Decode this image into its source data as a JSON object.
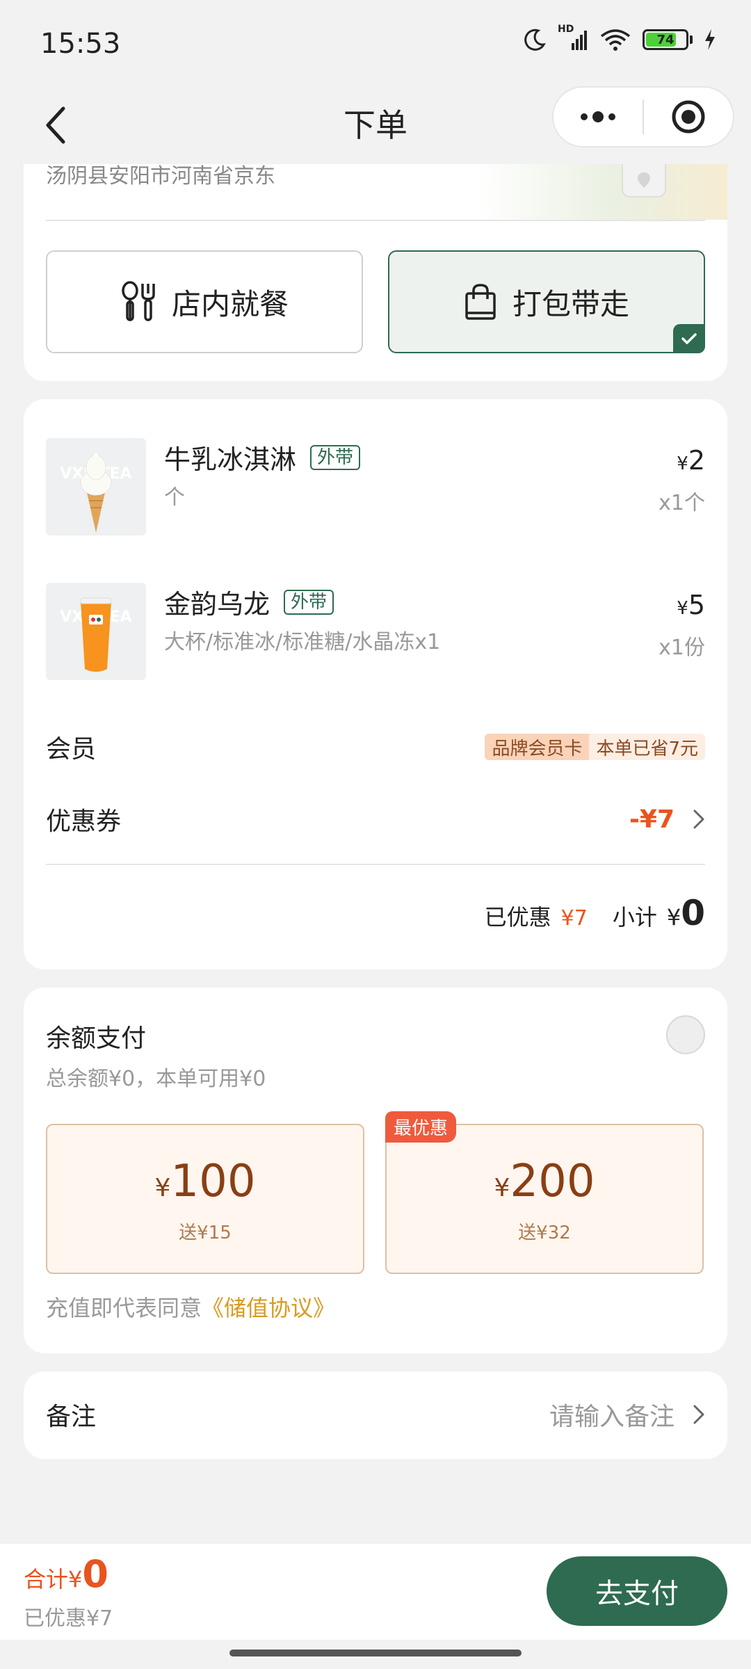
{
  "status": {
    "time": "15:53",
    "battery": "74",
    "network": "HD"
  },
  "nav": {
    "title": "下单"
  },
  "address": {
    "text": "汤阴县安阳市河南省京东"
  },
  "modes": {
    "dine_in": "店内就餐",
    "takeaway": "打包带走",
    "selected": "takeaway"
  },
  "items": [
    {
      "name": "牛乳冰淇淋",
      "tag": "外带",
      "spec": "个",
      "currency": "¥",
      "price": "2",
      "qty": "x1个"
    },
    {
      "name": "金韵乌龙",
      "tag": "外带",
      "spec": "大杯/标准冰/标准糖/水晶冻x1",
      "currency": "¥",
      "price": "5",
      "qty": "x1份"
    }
  ],
  "member": {
    "label": "会员",
    "badge": "品牌会员卡",
    "saved": "本单已省7元"
  },
  "coupon": {
    "label": "优惠券",
    "value": "-¥7"
  },
  "summary": {
    "discount_label": "已优惠",
    "discount_value": "¥7",
    "subtotal_label": "小计",
    "currency": "¥",
    "subtotal_value": "0"
  },
  "balance": {
    "title": "余额支付",
    "subtitle": "总余额¥0，本单可用¥0",
    "options": [
      {
        "currency": "¥",
        "amount": "100",
        "bonus": "送¥15"
      },
      {
        "currency": "¥",
        "amount": "200",
        "bonus": "送¥32",
        "tag": "最优惠"
      }
    ],
    "agreement_prefix": "充值即代表同意",
    "agreement_link": "《储值协议》"
  },
  "note": {
    "label": "备注",
    "placeholder": "请输入备注"
  },
  "footer": {
    "total_label": "合计",
    "currency": "¥",
    "total_value": "0",
    "saved_text": "已优惠¥7",
    "pay_label": "去支付"
  },
  "colors": {
    "brand_green": "#2e6b50",
    "price_orange": "#e8541e",
    "link_gold": "#d99a1f",
    "card_bg": "#ffffff",
    "page_bg": "#f2f2f2"
  }
}
